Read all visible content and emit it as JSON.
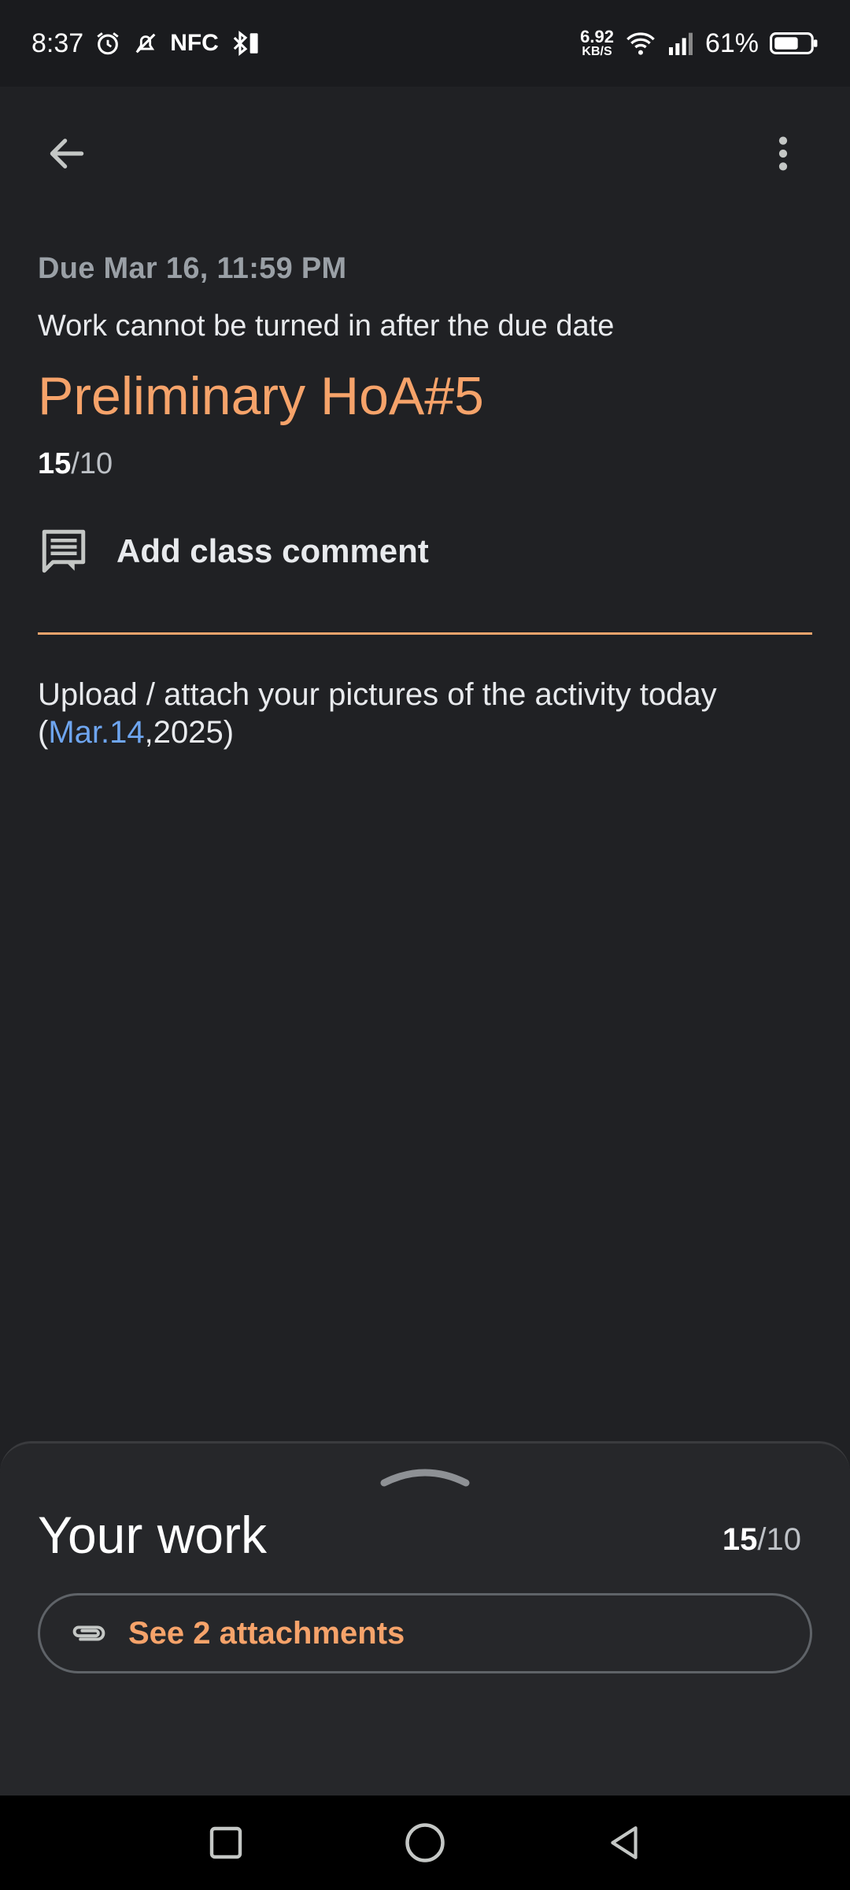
{
  "status_bar": {
    "time": "8:37",
    "nfc": "NFC",
    "speed_value": "6.92",
    "speed_unit": "KB/S",
    "battery": "61%"
  },
  "icons": {
    "back": "arrow-left-icon",
    "more": "more-vert-icon",
    "comment": "comment-icon",
    "attachment": "paperclip-icon",
    "handle": "chevron-up-icon"
  },
  "assignment": {
    "due": "Due Mar 16, 11:59 PM",
    "late_note": "Work cannot be turned in after the due date",
    "title": "Preliminary HoA#5",
    "points_earned": "15",
    "points_total": "/10",
    "add_comment": "Add class comment",
    "instructions_text": "Upload / attach your pictures of the activity today (",
    "instructions_link": "Mar.14",
    "instructions_tail": ",2025)"
  },
  "your_work": {
    "title": "Your work",
    "points_earned": "15",
    "points_total": "/10",
    "attachments_label": "See 2 attachments"
  },
  "colors": {
    "accent": "#f6a36a",
    "link": "#6ea5ef",
    "background": "#202124"
  }
}
